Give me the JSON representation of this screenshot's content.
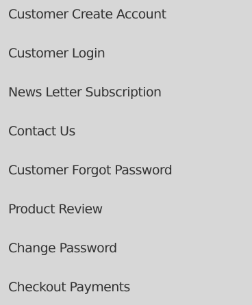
{
  "menu": {
    "items": [
      {
        "label": "Customer Create Account"
      },
      {
        "label": "Customer Login"
      },
      {
        "label": "News Letter Subscription"
      },
      {
        "label": "Contact Us"
      },
      {
        "label": "Customer Forgot Password"
      },
      {
        "label": "Product Review"
      },
      {
        "label": "Change Password"
      },
      {
        "label": "Checkout Payments"
      }
    ]
  },
  "colors": {
    "background": "#d7d7d7",
    "text": "#333333"
  }
}
